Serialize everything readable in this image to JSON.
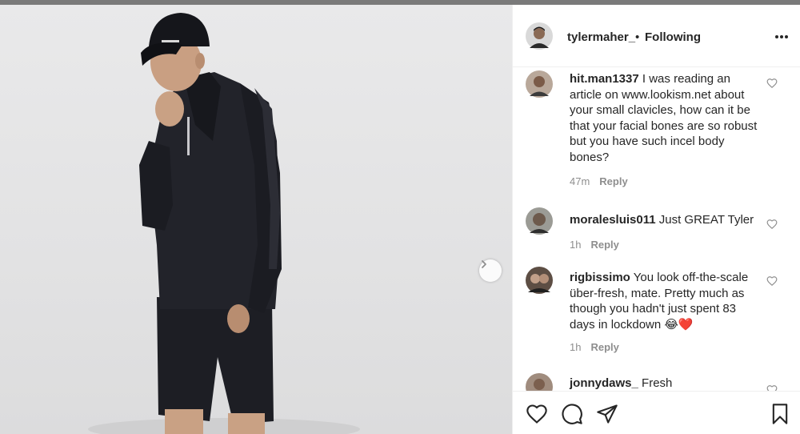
{
  "post": {
    "username": "tylermaher_",
    "separator": "•",
    "follow_label": "Following"
  },
  "comments": [
    {
      "user": "hit.man1337",
      "text": "I was reading an article on www.lookism.net about your small clavicles, how can it be that your facial bones are so robust but you have such incel body bones?",
      "time": "47m",
      "reply": "Reply"
    },
    {
      "user": "moralesluis011",
      "text": "Just GREAT Tyler",
      "time": "1h",
      "reply": "Reply"
    },
    {
      "user": "rigbissimo",
      "text": "You look off-the-scale über-fresh, mate. Pretty much as though you hadn't just spent 83 days in lockdown 😂❤️",
      "time": "1h",
      "reply": "Reply"
    },
    {
      "user": "jonnydaws_",
      "text": "Fresh",
      "time": "",
      "reply": ""
    }
  ],
  "icons": {
    "more": "more-horizontal-icon",
    "next": "chevron-right-icon",
    "like": "heart-outline-icon",
    "comment": "comment-bubble-icon",
    "share": "paper-plane-icon",
    "save": "bookmark-icon"
  },
  "colors": {
    "text": "#262626",
    "muted": "#8e8e8e",
    "border": "#efefef",
    "background_photo": "#e4e4e5"
  }
}
